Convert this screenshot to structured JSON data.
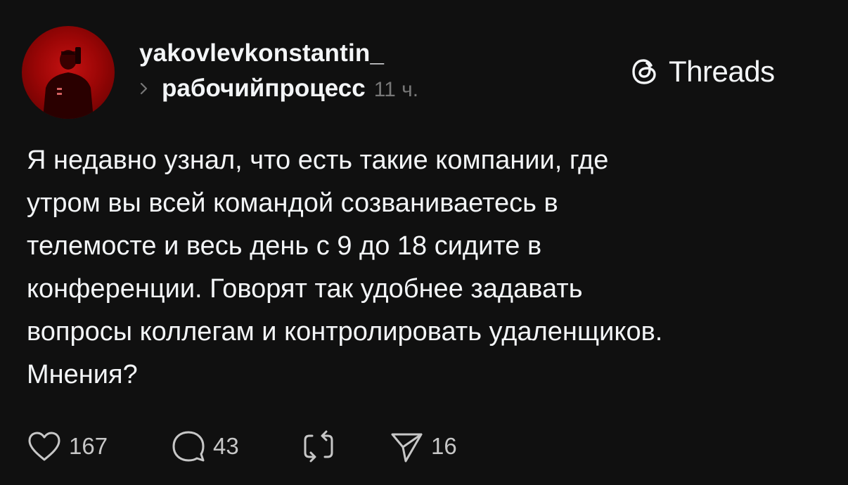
{
  "post": {
    "username": "yakovlevkonstantin_",
    "topic": "рабочийпроцесс",
    "time": "11 ч.",
    "brand": "Threads",
    "body_lines": [
      "Я недавно узнал, что есть такие компании, где",
      "утром вы всей командой созваниваетесь в",
      "телемосте и весь день с 9 до 18 сидите в",
      "конференции. Говорят так удобнее задавать",
      "вопросы коллегам и контролировать удаленщиков.",
      "Мнения?"
    ],
    "actions": {
      "likes": "167",
      "replies": "43",
      "shares": "16"
    }
  },
  "icons": {
    "avatar": "profile-photo",
    "topic_chevron": "chevron-right-icon",
    "brand_logo": "threads-logo-icon",
    "like": "heart-icon",
    "reply": "comment-icon",
    "repost": "repost-icon",
    "share": "send-icon"
  },
  "colors": {
    "background": "#101010",
    "text_primary": "#f3f5f7",
    "text_secondary": "#777777",
    "avatar_bg": "#b00a0a"
  }
}
